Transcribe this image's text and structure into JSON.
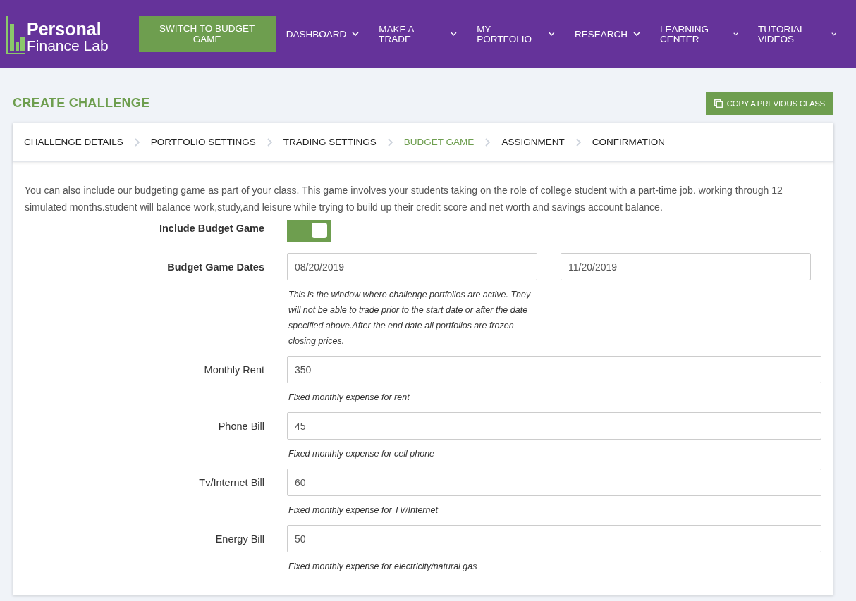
{
  "header": {
    "logo": {
      "line1": "Personal",
      "line2": "Finance Lab"
    },
    "switch_button": "SWITCH TO BUDGET GAME",
    "nav": [
      {
        "label": "DASHBOARD"
      },
      {
        "label": "MAKE A TRADE"
      },
      {
        "label": "MY PORTFOLIO"
      },
      {
        "label": "RESEARCH"
      },
      {
        "label": "LEARNING CENTER"
      },
      {
        "label": "TUTORIAL VIDEOS"
      }
    ]
  },
  "page_title": "CREATE CHALLENGE",
  "copy_button": "COPY A PREVIOUS CLASS",
  "steps": [
    {
      "label": "CHALLENGE DETAILS",
      "selected": false
    },
    {
      "label": "PORTFOLIO SETTINGS",
      "selected": false
    },
    {
      "label": "TRADING SETTINGS",
      "selected": false
    },
    {
      "label": "BUDGET GAME",
      "selected": true
    },
    {
      "label": "ASSIGNMENT",
      "selected": false
    },
    {
      "label": "CONFIRMATION",
      "selected": false
    }
  ],
  "intro": "You can also include our budgeting game as part of your class. This game involves your students taking on the role of college student with a part-time job. working through 12 simulated months.student will balance work,study,and leisure while trying to build up their credit score and net worth and savings account balance.",
  "fields": [
    {
      "kind": "toggle",
      "label": "Include Budget Game",
      "on": true
    },
    {
      "kind": "dates",
      "label": "Budget Game Dates",
      "start": "08/20/2019",
      "end": "11/20/2019",
      "hint": "This is the window where challenge portfolios are active. They will not be able to trade prior to the start date or after the date specified above.After the end date all portfolios are frozen closing prices."
    },
    {
      "kind": "input",
      "label": "Monthly Rent",
      "value": "350",
      "hint": "Fixed monthly expense for rent"
    },
    {
      "kind": "input",
      "label": "Phone Bill",
      "value": "45",
      "hint": "Fixed monthly expense for cell phone"
    },
    {
      "kind": "input",
      "label": "Tv/Internet Bill",
      "value": "60",
      "hint": "Fixed monthly expense for TV/Internet"
    },
    {
      "kind": "input",
      "label": "Energy Bill",
      "value": "50",
      "hint": "Fixed monthly expense for electricity/natural gas"
    }
  ]
}
